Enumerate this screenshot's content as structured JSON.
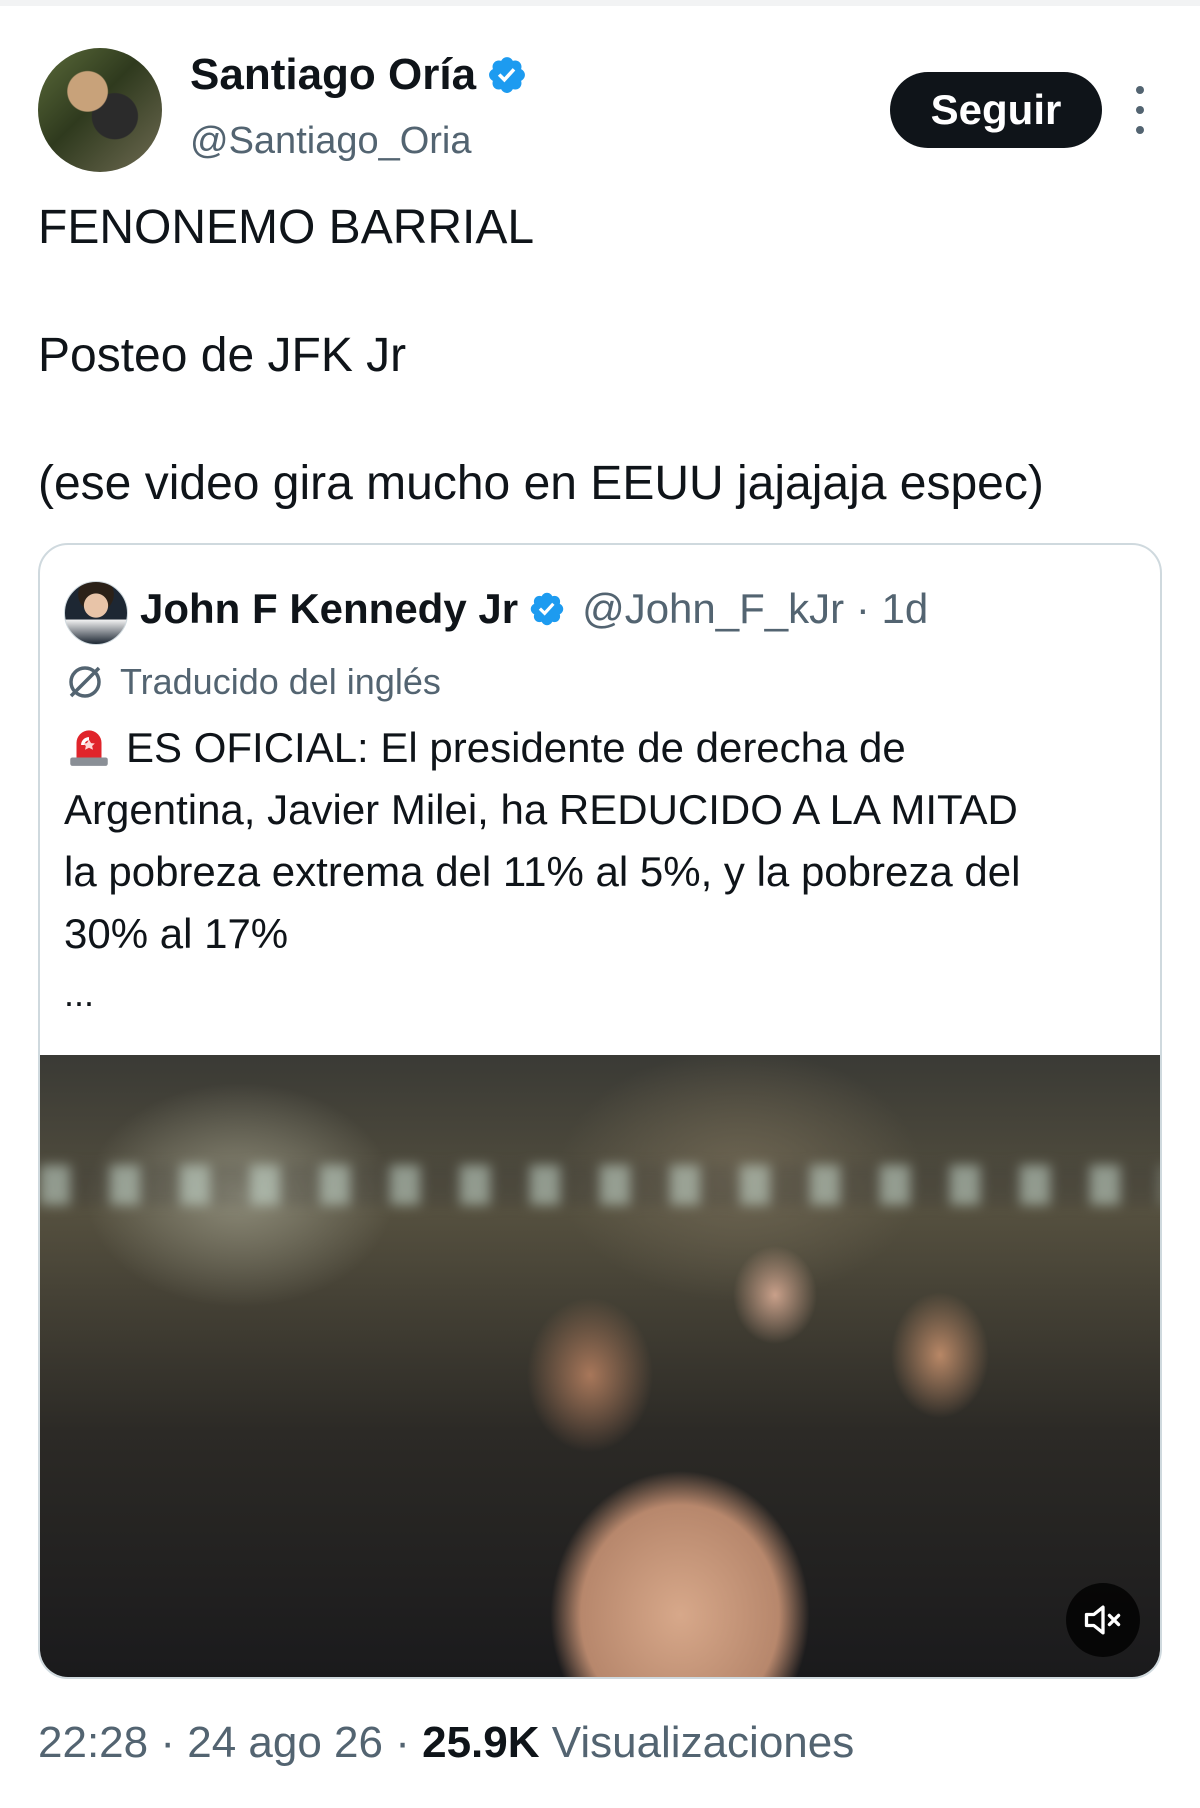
{
  "author": {
    "name": "Santiago Oría",
    "handle": "@Santiago_Oria",
    "follow_label": "Seguir"
  },
  "tweet": {
    "lines": [
      "FENONEMO BARRIAL",
      "Posteo de JFK Jr",
      "(ese video gira mucho en EEUU jajajaja espec)"
    ]
  },
  "quote": {
    "name": "John F Kennedy Jr",
    "handle": "@John_F_kJr",
    "separator": "·",
    "time": "1d",
    "translated_label": "Traducido del inglés",
    "body_lines": [
      "ES OFICIAL: El presidente de derecha de",
      "Argentina, Javier Milei, ha REDUCIDO A LA MITAD",
      "la pobreza extrema del 11% al 5%, y la pobreza del",
      "30% al 17%"
    ],
    "ellipsis": "..."
  },
  "footer": {
    "time": "22:28",
    "sep": "·",
    "date": "24 ago 26",
    "views_count": "25.9K",
    "views_label": "Visualizaciones"
  },
  "icons": {
    "verified": "verified-badge-icon",
    "more": "more-vertical-icon",
    "translate": "translate-icon",
    "siren": "siren-icon",
    "mute": "muted-speaker-icon"
  },
  "colors": {
    "verified": "#1d9bf0",
    "secondary_text": "#536471",
    "primary_text": "#0f1419",
    "border": "#cfd9de"
  }
}
